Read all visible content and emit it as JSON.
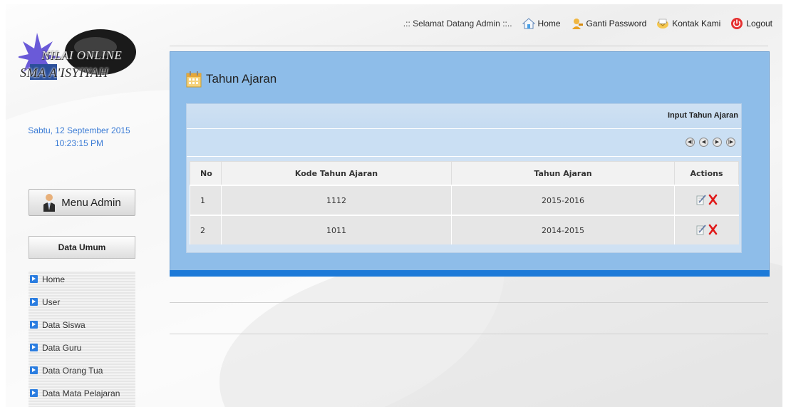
{
  "topbar": {
    "welcome": ".:: Selamat Datang Admin ::..",
    "home": "Home",
    "ganti_password": "Ganti Password",
    "kontak_kami": "Kontak Kami",
    "logout": "Logout"
  },
  "logo": {
    "line1": "NILAI ONLINE",
    "line2": "SMA A'ISYIYAH"
  },
  "datetime": {
    "date": "Sabtu, 12 September 2015",
    "time": "10:23:15 PM"
  },
  "sidebar": {
    "menu_admin": "Menu Admin",
    "section": "Data Umum",
    "items": [
      {
        "label": "Home"
      },
      {
        "label": "User"
      },
      {
        "label": "Data Siswa"
      },
      {
        "label": "Data Guru"
      },
      {
        "label": "Data Orang Tua"
      },
      {
        "label": "Data Mata Pelajaran"
      }
    ]
  },
  "main": {
    "title": "Tahun Ajaran",
    "input_link": "Input Tahun Ajaran",
    "columns": [
      "No",
      "Kode Tahun Ajaran",
      "Tahun Ajaran",
      "Actions"
    ],
    "rows": [
      {
        "no": "1",
        "kode": "1112",
        "tahun": "2015-2016"
      },
      {
        "no": "2",
        "kode": "1011",
        "tahun": "2014-2015"
      }
    ]
  },
  "colors": {
    "panel": "#8ebde9",
    "panel_bottom": "#1d7ad8",
    "date_text": "#3a7bd5"
  }
}
